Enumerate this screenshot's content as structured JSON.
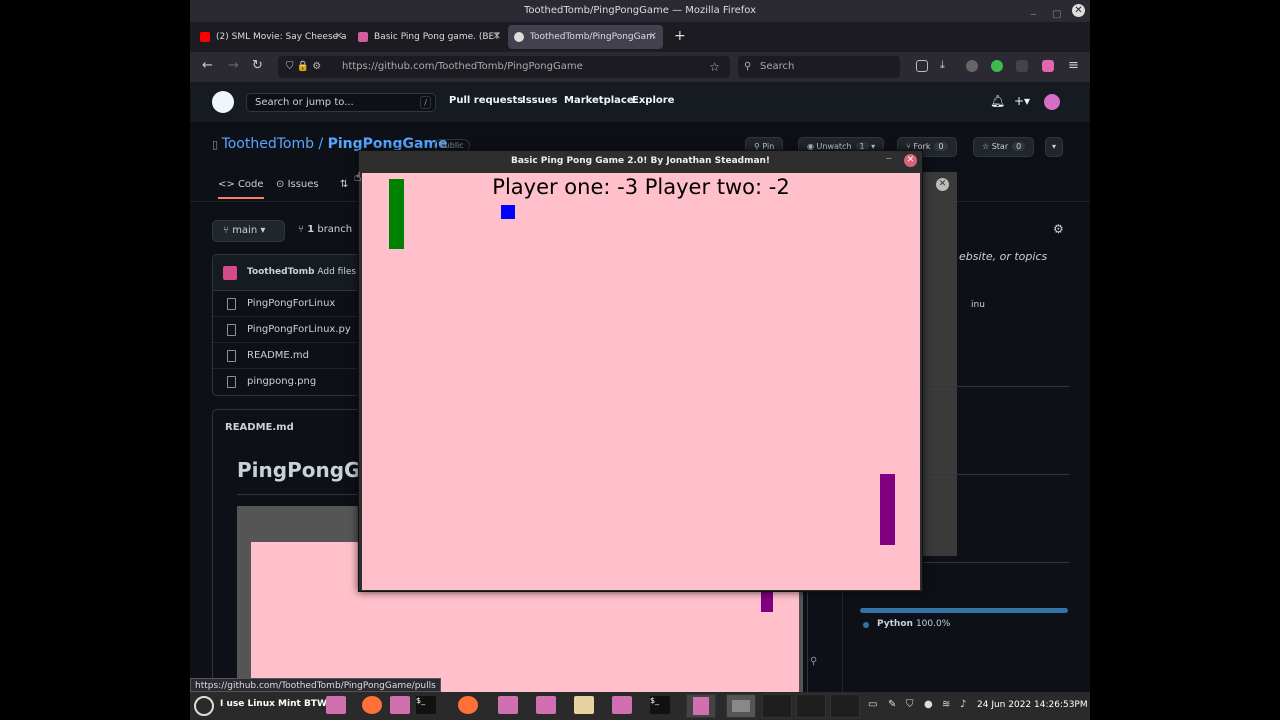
{
  "window": {
    "title": "ToothedTomb/PingPongGame — Mozilla Firefox"
  },
  "tabs": [
    {
      "label": "(2) SML Movie: Say Cheese a",
      "favicon_color": "#ff0000"
    },
    {
      "label": "Basic Ping Pong game. (BET",
      "favicon_color": "#d45d9f"
    },
    {
      "label": "ToothedTomb/PingPongGam",
      "favicon_color": "#dddddd"
    }
  ],
  "nav": {
    "url": "https://github.com/ToothedTomb/PingPongGame",
    "search_placeholder": "Search"
  },
  "github": {
    "search_placeholder": "Search or jump to...",
    "search_shortcut": "/",
    "nav": [
      "Pull requests",
      "Issues",
      "Marketplace",
      "Explore"
    ],
    "owner": "ToothedTomb",
    "separator": "/",
    "repo": "PingPongGame",
    "visibility": "Public",
    "pin_label": "Pin",
    "unwatch_label": "Unwatch",
    "unwatch_count": "1",
    "fork_label": "Fork",
    "fork_count": "0",
    "star_label": "Star",
    "star_count": "0",
    "repo_tabs": [
      "Code",
      "Issues"
    ],
    "branch": "main",
    "branch_count": "1",
    "branch_word": "branch",
    "commit_author": "ToothedTomb",
    "commit_msg": "Add files v",
    "files": [
      "PingPongForLinux",
      "PingPongForLinux.py",
      "README.md",
      "pingpong.png"
    ],
    "readme_label": "README.md",
    "readme_heading": "PingPongG",
    "about_text": "ebsite, or topics",
    "about_snippet": "inu",
    "language": "Python",
    "language_pct": "100.0%",
    "status_url": "https://github.com/ToothedTomb/PingPongGame/pulls"
  },
  "game": {
    "title": "Basic Ping Pong Game 2.0! By Jonathan Steadman!",
    "score_text": "Player one: -3 Player two: -2",
    "colors": {
      "background": "#ffc0cb",
      "left_paddle": "#008000",
      "right_paddle": "#800080",
      "ball": "#0000ff"
    }
  },
  "taskbar": {
    "menu_label": "I use Linux Mint BTW!",
    "datetime": "24 Jun 2022 14:26:53PM"
  }
}
